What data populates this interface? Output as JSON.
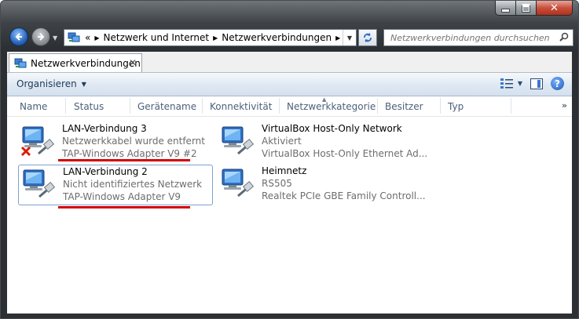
{
  "window": {
    "caption_buttons": {
      "minimize": "minimize",
      "maximize": "maximize",
      "close": "✕"
    }
  },
  "address_bar": {
    "prefix": "«",
    "breadcrumbs": [
      "Netzwerk und Internet",
      "Netzwerkverbindungen"
    ],
    "icon": "network-connections-icon"
  },
  "search": {
    "placeholder": "Netzwerkverbindungen durchsuchen"
  },
  "tab": {
    "label": "Netzwerkverbindungen",
    "close": "✕"
  },
  "toolbar": {
    "organize_label": "Organisieren"
  },
  "columns": [
    "Name",
    "Status",
    "Gerätename",
    "Konnektivität",
    "Netzwerkkategorie",
    "Besitzer",
    "Typ"
  ],
  "connections": [
    {
      "name": "LAN-Verbindung 3",
      "status": "Netzwerkkabel wurde entfernt",
      "device": "TAP-Windows Adapter V9 #2",
      "error": true,
      "underlined": true
    },
    {
      "name": "VirtualBox Host-Only Network",
      "status": "Aktiviert",
      "device": "VirtualBox Host-Only Ethernet Ad...",
      "error": false,
      "underlined": false
    },
    {
      "name": "LAN-Verbindung 2",
      "status": "Nicht identifiziertes Netzwerk",
      "device": "TAP-Windows Adapter V9",
      "error": false,
      "underlined": true,
      "selected": true
    },
    {
      "name": "Heimnetz",
      "status": "RS505",
      "device": "Realtek PCIe GBE Family Controll...",
      "error": false,
      "underlined": false
    }
  ],
  "colors": {
    "underline": "#d40000",
    "selection_border": "#7da2ce"
  }
}
